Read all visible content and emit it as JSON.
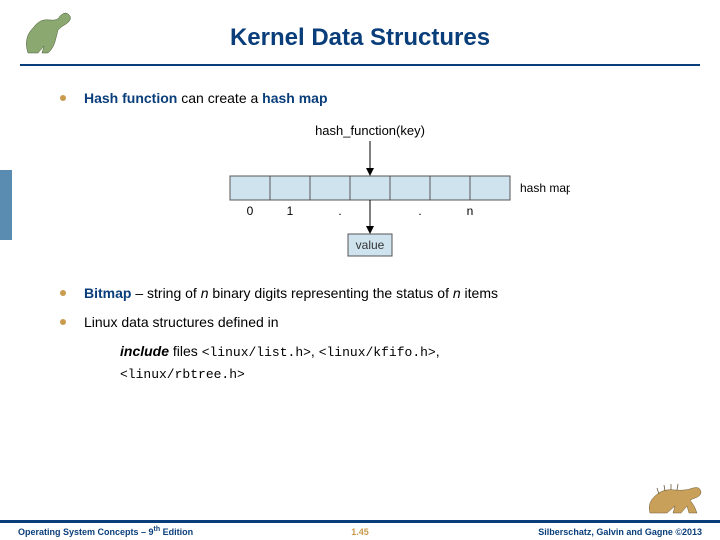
{
  "title": "Kernel Data Structures",
  "bullets": {
    "b1_term": "Hash function",
    "b1_mid": " can create a ",
    "b1_term2": "hash map",
    "b2_term": "Bitmap",
    "b2_dash": " – string of ",
    "b2_n1": "n",
    "b2_mid": " binary digits representing the status of ",
    "b2_n2": "n",
    "b2_end": " items",
    "b3": "Linux data structures defined in",
    "b3_indent_pre": "include",
    "b3_indent_mid": " files ",
    "b3_file1": "<linux/list.h>",
    "b3_comma1": ", ",
    "b3_file2": "<linux/kfifo.h>",
    "b3_comma2": ", ",
    "b3_file3": "<linux/rbtree.h>"
  },
  "diagram": {
    "func_label": "hash_function(key)",
    "map_label": "hash map",
    "value_label": "value",
    "idx0": "0",
    "idx1": "1",
    "idxdot1": ".",
    "idxdot2": ".",
    "idxn": "n"
  },
  "footer": {
    "left_pre": "Operating System Concepts – 9",
    "left_sup": "th",
    "left_post": " Edition",
    "center": "1.45",
    "right": "Silberschatz, Galvin and Gagne ©2013"
  }
}
